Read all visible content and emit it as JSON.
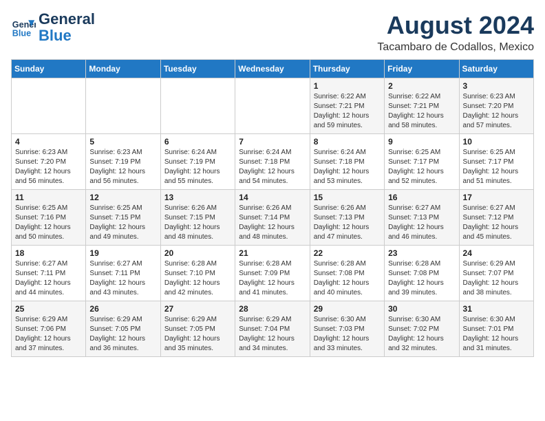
{
  "header": {
    "logo_line1": "General",
    "logo_line2": "Blue",
    "month_year": "August 2024",
    "location": "Tacambaro de Codallos, Mexico"
  },
  "days_of_week": [
    "Sunday",
    "Monday",
    "Tuesday",
    "Wednesday",
    "Thursday",
    "Friday",
    "Saturday"
  ],
  "weeks": [
    [
      {
        "day": "",
        "sunrise": "",
        "sunset": "",
        "daylight": ""
      },
      {
        "day": "",
        "sunrise": "",
        "sunset": "",
        "daylight": ""
      },
      {
        "day": "",
        "sunrise": "",
        "sunset": "",
        "daylight": ""
      },
      {
        "day": "",
        "sunrise": "",
        "sunset": "",
        "daylight": ""
      },
      {
        "day": "1",
        "sunrise": "Sunrise: 6:22 AM",
        "sunset": "Sunset: 7:21 PM",
        "daylight": "Daylight: 12 hours and 59 minutes."
      },
      {
        "day": "2",
        "sunrise": "Sunrise: 6:22 AM",
        "sunset": "Sunset: 7:21 PM",
        "daylight": "Daylight: 12 hours and 58 minutes."
      },
      {
        "day": "3",
        "sunrise": "Sunrise: 6:23 AM",
        "sunset": "Sunset: 7:20 PM",
        "daylight": "Daylight: 12 hours and 57 minutes."
      }
    ],
    [
      {
        "day": "4",
        "sunrise": "Sunrise: 6:23 AM",
        "sunset": "Sunset: 7:20 PM",
        "daylight": "Daylight: 12 hours and 56 minutes."
      },
      {
        "day": "5",
        "sunrise": "Sunrise: 6:23 AM",
        "sunset": "Sunset: 7:19 PM",
        "daylight": "Daylight: 12 hours and 56 minutes."
      },
      {
        "day": "6",
        "sunrise": "Sunrise: 6:24 AM",
        "sunset": "Sunset: 7:19 PM",
        "daylight": "Daylight: 12 hours and 55 minutes."
      },
      {
        "day": "7",
        "sunrise": "Sunrise: 6:24 AM",
        "sunset": "Sunset: 7:18 PM",
        "daylight": "Daylight: 12 hours and 54 minutes."
      },
      {
        "day": "8",
        "sunrise": "Sunrise: 6:24 AM",
        "sunset": "Sunset: 7:18 PM",
        "daylight": "Daylight: 12 hours and 53 minutes."
      },
      {
        "day": "9",
        "sunrise": "Sunrise: 6:25 AM",
        "sunset": "Sunset: 7:17 PM",
        "daylight": "Daylight: 12 hours and 52 minutes."
      },
      {
        "day": "10",
        "sunrise": "Sunrise: 6:25 AM",
        "sunset": "Sunset: 7:17 PM",
        "daylight": "Daylight: 12 hours and 51 minutes."
      }
    ],
    [
      {
        "day": "11",
        "sunrise": "Sunrise: 6:25 AM",
        "sunset": "Sunset: 7:16 PM",
        "daylight": "Daylight: 12 hours and 50 minutes."
      },
      {
        "day": "12",
        "sunrise": "Sunrise: 6:25 AM",
        "sunset": "Sunset: 7:15 PM",
        "daylight": "Daylight: 12 hours and 49 minutes."
      },
      {
        "day": "13",
        "sunrise": "Sunrise: 6:26 AM",
        "sunset": "Sunset: 7:15 PM",
        "daylight": "Daylight: 12 hours and 48 minutes."
      },
      {
        "day": "14",
        "sunrise": "Sunrise: 6:26 AM",
        "sunset": "Sunset: 7:14 PM",
        "daylight": "Daylight: 12 hours and 48 minutes."
      },
      {
        "day": "15",
        "sunrise": "Sunrise: 6:26 AM",
        "sunset": "Sunset: 7:13 PM",
        "daylight": "Daylight: 12 hours and 47 minutes."
      },
      {
        "day": "16",
        "sunrise": "Sunrise: 6:27 AM",
        "sunset": "Sunset: 7:13 PM",
        "daylight": "Daylight: 12 hours and 46 minutes."
      },
      {
        "day": "17",
        "sunrise": "Sunrise: 6:27 AM",
        "sunset": "Sunset: 7:12 PM",
        "daylight": "Daylight: 12 hours and 45 minutes."
      }
    ],
    [
      {
        "day": "18",
        "sunrise": "Sunrise: 6:27 AM",
        "sunset": "Sunset: 7:11 PM",
        "daylight": "Daylight: 12 hours and 44 minutes."
      },
      {
        "day": "19",
        "sunrise": "Sunrise: 6:27 AM",
        "sunset": "Sunset: 7:11 PM",
        "daylight": "Daylight: 12 hours and 43 minutes."
      },
      {
        "day": "20",
        "sunrise": "Sunrise: 6:28 AM",
        "sunset": "Sunset: 7:10 PM",
        "daylight": "Daylight: 12 hours and 42 minutes."
      },
      {
        "day": "21",
        "sunrise": "Sunrise: 6:28 AM",
        "sunset": "Sunset: 7:09 PM",
        "daylight": "Daylight: 12 hours and 41 minutes."
      },
      {
        "day": "22",
        "sunrise": "Sunrise: 6:28 AM",
        "sunset": "Sunset: 7:08 PM",
        "daylight": "Daylight: 12 hours and 40 minutes."
      },
      {
        "day": "23",
        "sunrise": "Sunrise: 6:28 AM",
        "sunset": "Sunset: 7:08 PM",
        "daylight": "Daylight: 12 hours and 39 minutes."
      },
      {
        "day": "24",
        "sunrise": "Sunrise: 6:29 AM",
        "sunset": "Sunset: 7:07 PM",
        "daylight": "Daylight: 12 hours and 38 minutes."
      }
    ],
    [
      {
        "day": "25",
        "sunrise": "Sunrise: 6:29 AM",
        "sunset": "Sunset: 7:06 PM",
        "daylight": "Daylight: 12 hours and 37 minutes."
      },
      {
        "day": "26",
        "sunrise": "Sunrise: 6:29 AM",
        "sunset": "Sunset: 7:05 PM",
        "daylight": "Daylight: 12 hours and 36 minutes."
      },
      {
        "day": "27",
        "sunrise": "Sunrise: 6:29 AM",
        "sunset": "Sunset: 7:05 PM",
        "daylight": "Daylight: 12 hours and 35 minutes."
      },
      {
        "day": "28",
        "sunrise": "Sunrise: 6:29 AM",
        "sunset": "Sunset: 7:04 PM",
        "daylight": "Daylight: 12 hours and 34 minutes."
      },
      {
        "day": "29",
        "sunrise": "Sunrise: 6:30 AM",
        "sunset": "Sunset: 7:03 PM",
        "daylight": "Daylight: 12 hours and 33 minutes."
      },
      {
        "day": "30",
        "sunrise": "Sunrise: 6:30 AM",
        "sunset": "Sunset: 7:02 PM",
        "daylight": "Daylight: 12 hours and 32 minutes."
      },
      {
        "day": "31",
        "sunrise": "Sunrise: 6:30 AM",
        "sunset": "Sunset: 7:01 PM",
        "daylight": "Daylight: 12 hours and 31 minutes."
      }
    ]
  ]
}
